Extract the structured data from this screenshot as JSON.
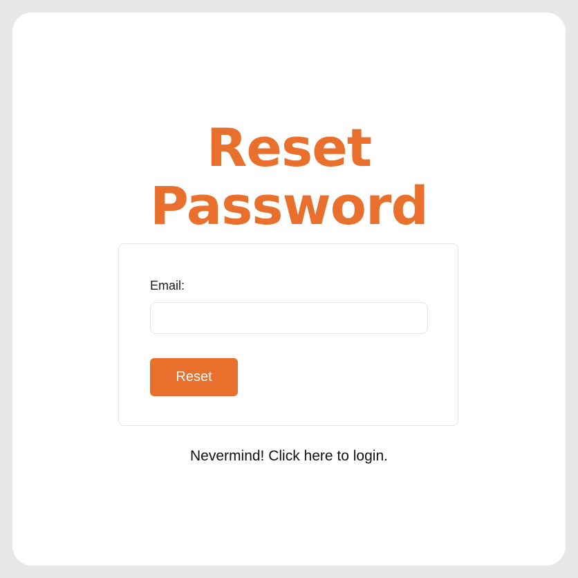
{
  "colors": {
    "accent": "#E8702C",
    "page_border": "#E7E7E7",
    "card_border": "#E6E6E6"
  },
  "page": {
    "title_line1": "Reset",
    "title_line2": "Password"
  },
  "form": {
    "email_label": "Email:",
    "email_value": "",
    "email_placeholder": "",
    "submit_label": "Reset"
  },
  "footer": {
    "login_link": "Nevermind! Click here to login."
  }
}
